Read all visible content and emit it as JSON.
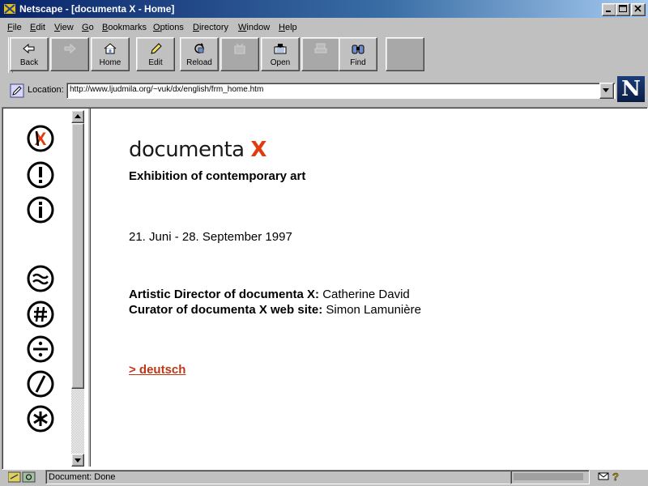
{
  "window": {
    "title": "Netscape - [documenta X - Home]",
    "minimize_icon": "minimize-icon",
    "maximize_icon": "maximize-icon",
    "close_icon": "close-icon"
  },
  "menu": [
    "File",
    "Edit",
    "View",
    "Go",
    "Bookmarks",
    "Options",
    "Directory",
    "Window",
    "Help"
  ],
  "toolbar": {
    "back": "Back",
    "forward": "",
    "home": "Home",
    "edit": "Edit",
    "reload": "Reload",
    "images": "",
    "open": "Open",
    "print": "",
    "find": "Find",
    "stop": ""
  },
  "location": {
    "label": "Location:",
    "url": "http://www.ljudmila.org/~vuk/dx/english/frm_home.htm"
  },
  "brand_logo": "N",
  "side_nav": [
    {
      "name": "dx-logo-icon",
      "glyph": "X"
    },
    {
      "name": "exclamation-icon",
      "glyph": "!"
    },
    {
      "name": "info-icon",
      "glyph": "i"
    },
    {
      "name": "approx-icon",
      "glyph": "≈"
    },
    {
      "name": "hash-icon",
      "glyph": "#"
    },
    {
      "name": "divide-icon",
      "glyph": "÷"
    },
    {
      "name": "slash-icon",
      "glyph": "/"
    },
    {
      "name": "asterisk-icon",
      "glyph": "*"
    }
  ],
  "main": {
    "logo_word": "documenta ",
    "logo_x": "X",
    "subtitle": "Exhibition of contemporary art",
    "dates": "21. Juni - 28. September 1997",
    "director_label": "Artistic Director of documenta X:",
    "director_name": " Catherine David",
    "curator_label": "Curator of documenta X web site:",
    "curator_name": " Simon Lamunière",
    "link_deutsch": "> deutsch"
  },
  "status": {
    "text": "Document: Done"
  },
  "colors": {
    "accent_red": "#e23b10",
    "link": "#c13515",
    "titlebar": "#0a246a"
  }
}
